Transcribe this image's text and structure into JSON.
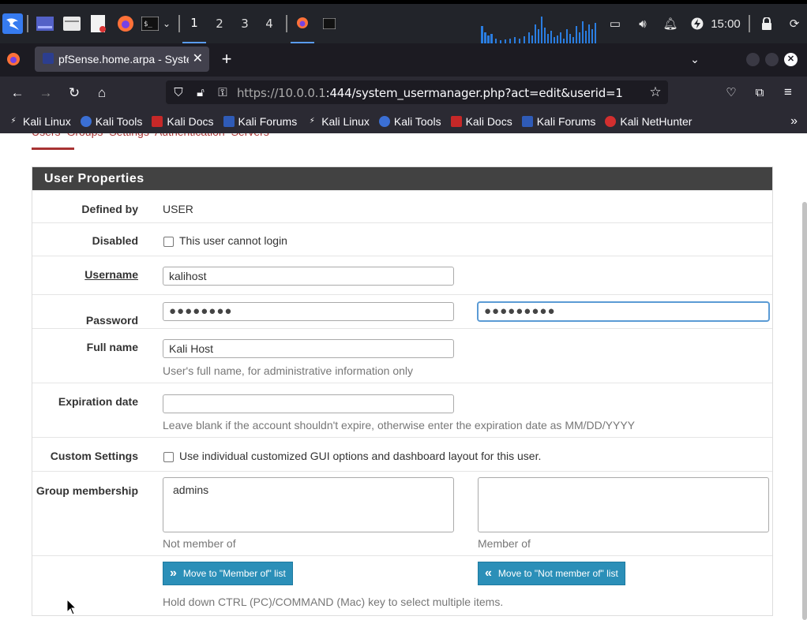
{
  "taskbar": {
    "workspaces": [
      "1",
      "2",
      "3",
      "4"
    ],
    "clock": "15:00"
  },
  "browser": {
    "tab_title": "pfSense.home.arpa - System",
    "url_host": "https://10.0.0.1",
    "url_path": ":444/system_usermanager.php?act=edit&userid=1",
    "bookmarks": [
      "Kali Linux",
      "Kali Tools",
      "Kali Docs",
      "Kali Forums",
      "Kali Linux",
      "Kali Tools",
      "Kali Docs",
      "Kali Forums",
      "Kali NetHunter"
    ]
  },
  "page": {
    "tabs_remnant": "Users    Groups    Settings    Authentication Servers",
    "panel_title": "User Properties",
    "defined_by": {
      "label": "Defined by",
      "value": "USER"
    },
    "disabled": {
      "label": "Disabled",
      "checkbox_label": "This user cannot login"
    },
    "username": {
      "label": "Username",
      "value": "kalihost"
    },
    "password": {
      "label": "Password",
      "value": "●●●●●●●●",
      "confirm": "●●●●●●●●●"
    },
    "full_name": {
      "label": "Full name",
      "value": "Kali Host",
      "help": "User's full name, for administrative information only"
    },
    "expiration": {
      "label": "Expiration date",
      "value": "",
      "help": "Leave blank if the account shouldn't expire, otherwise enter the expiration date as MM/DD/YYYY"
    },
    "custom_settings": {
      "label": "Custom Settings",
      "checkbox_label": "Use individual customized GUI options and dashboard layout for this user."
    },
    "group_membership": {
      "label": "Group membership",
      "not_member_options": [
        "admins"
      ],
      "not_member_caption": "Not member of",
      "member_caption": "Member of",
      "move_to_member": "Move to \"Member of\" list",
      "move_to_not_member": "Move to \"Not member of\" list",
      "help": "Hold down CTRL (PC)/COMMAND (Mac) key to select multiple items."
    }
  }
}
